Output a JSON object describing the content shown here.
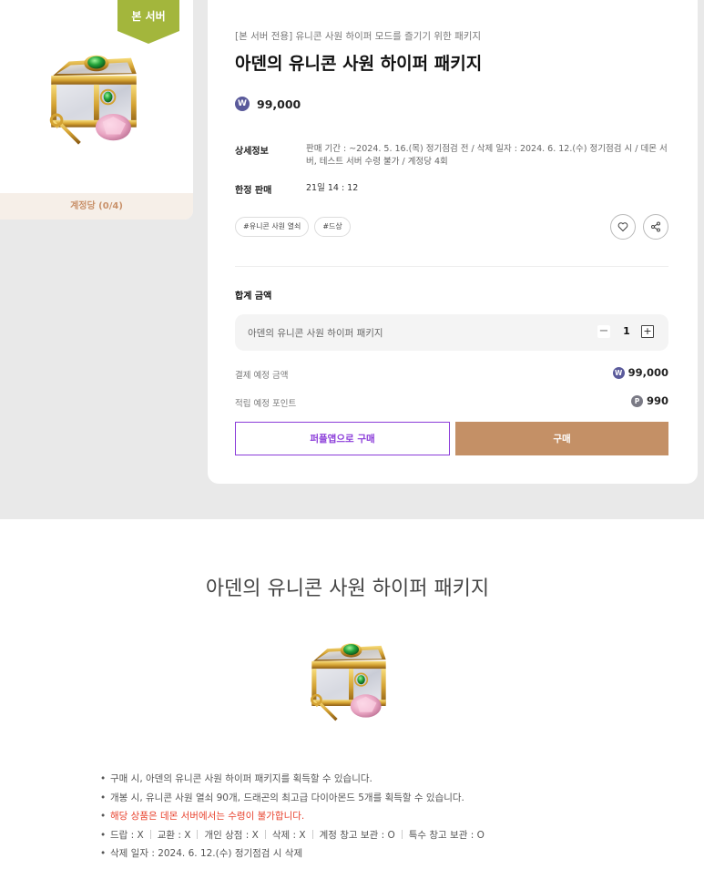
{
  "colors": {
    "accent_brown": "#c49066",
    "accent_purple": "#8b3cd9",
    "ribbon_green": "#a3b63c",
    "notice_red": "#e8432f"
  },
  "left_card": {
    "server_badge": "본 서버",
    "limit_text": "계정당 (0/4)"
  },
  "panel": {
    "subtitle": "[본 서버 전용] 유니콘 사원 하이퍼 모드를 즐기기 위한 패키지",
    "title": "아덴의 유니콘 사원 하이퍼 패키지",
    "price_coin": "W",
    "price": "99,000",
    "detail_label": "상세정보",
    "detail_line1": "판매 기간 : ~2024. 5. 16.(목) 정기점검 전 / 삭제 일자 : 2024. 6. 12.(수) 정기점검 시 / 데몬 서",
    "detail_line2": "버, 테스트 서버 수령 불가 / 계정당 4회",
    "limited_label": "한정 판매",
    "limited_value": "21일 14 : 12",
    "tags": [
      "#유니콘 사원 열쇠",
      "#드상"
    ],
    "like_icon": "heart-icon",
    "share_icon": "share-icon",
    "total_label": "합계 금액",
    "qty_item_name": "아덴의 유니콘 사원 하이퍼 패키지",
    "qty_minus": "−",
    "qty_value": "1",
    "qty_plus": "+",
    "pay_label": "결제 예정 금액",
    "pay_coin": "W",
    "pay_value": "99,000",
    "point_label": "적립 예정 포인트",
    "point_coin": "P",
    "point_value": "990",
    "app_button": "퍼플앱으로 구매",
    "buy_button": "구매"
  },
  "detail": {
    "title": "아덴의 유니콘 사원 하이퍼 패키지",
    "items": [
      "구매 시, 아덴의 유니콘 사원 하이퍼 패키지를 획득할 수 있습니다.",
      "개봉 시, 유니콘 사원 열쇠 90개, 드래곤의 최고급 다이아몬드 5개를 획득할 수 있습니다.",
      "해당 상품은 데몬 서버에서는 수령이 불가합니다."
    ],
    "attrs": [
      "드랍 : X",
      "교환 : X",
      "개인 상점 : X",
      "삭제 : X",
      "계정 창고 보관 : O",
      "특수 창고 보관 : O"
    ],
    "delete_date": "삭제 일자 : 2024. 6. 12.(수) 정기점검 시 삭제"
  }
}
